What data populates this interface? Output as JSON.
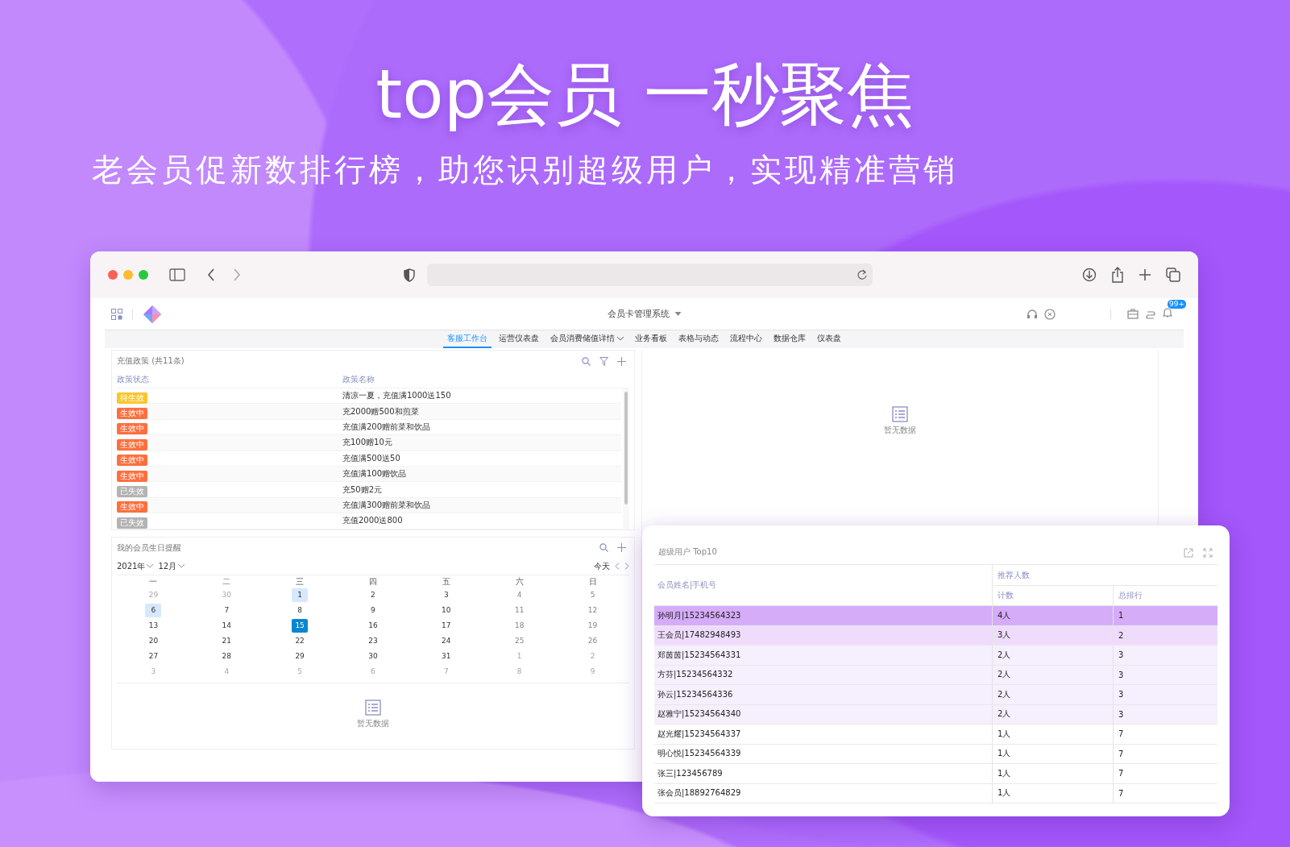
{
  "headline": {
    "title": "top会员 一秒聚焦",
    "subtitle": "老会员促新数排行榜，助您识别超级用户，实现精准营销"
  },
  "app": {
    "title": "会员卡管理系统",
    "badge": "99+",
    "nav": [
      {
        "label": "客服工作台",
        "selected": true,
        "has_menu": false
      },
      {
        "label": "运营仪表盘",
        "selected": false,
        "has_menu": false
      },
      {
        "label": "会员消费储值详情",
        "selected": false,
        "has_menu": true
      },
      {
        "label": "业务看板",
        "selected": false,
        "has_menu": false
      },
      {
        "label": "表格与动态",
        "selected": false,
        "has_menu": false
      },
      {
        "label": "流程中心",
        "selected": false,
        "has_menu": false
      },
      {
        "label": "数据仓库",
        "selected": false,
        "has_menu": false
      },
      {
        "label": "仪表盘",
        "selected": false,
        "has_menu": false
      }
    ]
  },
  "policy_table": {
    "title": "充值政策 (共11条)",
    "columns": [
      "政策状态",
      "政策名称"
    ],
    "rows": [
      {
        "status": "待生效",
        "kind": "pending",
        "name": "清凉一夏，充值满1000送150"
      },
      {
        "status": "生效中",
        "kind": "active",
        "name": "充2000赠500和煎菜"
      },
      {
        "status": "生效中",
        "kind": "active",
        "name": "充值满200赠前菜和饮品"
      },
      {
        "status": "生效中",
        "kind": "active",
        "name": "充100赠10元"
      },
      {
        "status": "生效中",
        "kind": "active",
        "name": "充值满500送50"
      },
      {
        "status": "生效中",
        "kind": "active",
        "name": "充值满100赠饮品"
      },
      {
        "status": "已失效",
        "kind": "expired",
        "name": "充50赠2元"
      },
      {
        "status": "生效中",
        "kind": "active",
        "name": "充值满300赠前菜和饮品"
      },
      {
        "status": "已失效",
        "kind": "expired",
        "name": "充值2000送800"
      }
    ]
  },
  "birthday_calendar": {
    "title": "我的会员生日提醒",
    "year": "2021年",
    "month": "12月",
    "today": "今天",
    "weekdays": [
      "一",
      "二",
      "三",
      "四",
      "五",
      "六",
      "日"
    ],
    "weeks": [
      [
        {
          "day": "29",
          "kind": "outside",
          "marked": false,
          "selected": false
        },
        {
          "day": "30",
          "kind": "outside",
          "marked": false,
          "selected": false
        },
        {
          "day": "1",
          "kind": "weekday",
          "marked": true,
          "selected": false
        },
        {
          "day": "2",
          "kind": "weekday",
          "marked": false,
          "selected": false
        },
        {
          "day": "3",
          "kind": "weekday",
          "marked": false,
          "selected": false
        },
        {
          "day": "4",
          "kind": "weekend",
          "marked": false,
          "selected": false
        },
        {
          "day": "5",
          "kind": "weekend",
          "marked": false,
          "selected": false
        }
      ],
      [
        {
          "day": "6",
          "kind": "weekday",
          "marked": true,
          "selected": false
        },
        {
          "day": "7",
          "kind": "weekday",
          "marked": false,
          "selected": false
        },
        {
          "day": "8",
          "kind": "weekday",
          "marked": false,
          "selected": false
        },
        {
          "day": "9",
          "kind": "weekday",
          "marked": false,
          "selected": false
        },
        {
          "day": "10",
          "kind": "weekday",
          "marked": false,
          "selected": false
        },
        {
          "day": "11",
          "kind": "weekend",
          "marked": false,
          "selected": false
        },
        {
          "day": "12",
          "kind": "weekend",
          "marked": false,
          "selected": false
        }
      ],
      [
        {
          "day": "13",
          "kind": "weekday",
          "marked": false,
          "selected": false
        },
        {
          "day": "14",
          "kind": "weekday",
          "marked": false,
          "selected": false
        },
        {
          "day": "15",
          "kind": "weekday",
          "marked": false,
          "selected": true
        },
        {
          "day": "16",
          "kind": "weekday",
          "marked": false,
          "selected": false
        },
        {
          "day": "17",
          "kind": "weekday",
          "marked": false,
          "selected": false
        },
        {
          "day": "18",
          "kind": "weekend",
          "marked": false,
          "selected": false
        },
        {
          "day": "19",
          "kind": "weekend",
          "marked": false,
          "selected": false
        }
      ],
      [
        {
          "day": "20",
          "kind": "weekday",
          "marked": false,
          "selected": false
        },
        {
          "day": "21",
          "kind": "weekday",
          "marked": false,
          "selected": false
        },
        {
          "day": "22",
          "kind": "weekday",
          "marked": false,
          "selected": false
        },
        {
          "day": "23",
          "kind": "weekday",
          "marked": false,
          "selected": false
        },
        {
          "day": "24",
          "kind": "weekday",
          "marked": false,
          "selected": false
        },
        {
          "day": "25",
          "kind": "weekend",
          "marked": false,
          "selected": false
        },
        {
          "day": "26",
          "kind": "weekend",
          "marked": false,
          "selected": false
        }
      ],
      [
        {
          "day": "27",
          "kind": "weekday",
          "marked": false,
          "selected": false
        },
        {
          "day": "28",
          "kind": "weekday",
          "marked": false,
          "selected": false
        },
        {
          "day": "29",
          "kind": "weekday",
          "marked": false,
          "selected": false
        },
        {
          "day": "30",
          "kind": "weekday",
          "marked": false,
          "selected": false
        },
        {
          "day": "31",
          "kind": "weekday",
          "marked": false,
          "selected": false
        },
        {
          "day": "1",
          "kind": "outside",
          "marked": false,
          "selected": false
        },
        {
          "day": "2",
          "kind": "outside",
          "marked": false,
          "selected": false
        }
      ],
      [
        {
          "day": "3",
          "kind": "outside",
          "marked": false,
          "selected": false
        },
        {
          "day": "4",
          "kind": "outside",
          "marked": false,
          "selected": false
        },
        {
          "day": "5",
          "kind": "outside",
          "marked": false,
          "selected": false
        },
        {
          "day": "6",
          "kind": "outside",
          "marked": false,
          "selected": false
        },
        {
          "day": "7",
          "kind": "outside",
          "marked": false,
          "selected": false
        },
        {
          "day": "8",
          "kind": "outside",
          "marked": false,
          "selected": false
        },
        {
          "day": "9",
          "kind": "outside",
          "marked": false,
          "selected": false
        }
      ]
    ],
    "empty_text": "暂无数据"
  },
  "right_panel": {
    "empty_text": "暂无数据"
  },
  "top10": {
    "title": "超级用户 Top10",
    "name_column": "会员姓名|手机号",
    "group_column": "推荐人数",
    "count_column": "计数",
    "rank_column": "总排行",
    "rows": [
      {
        "name": "孙明月|15234564323",
        "count": "4人",
        "rank": "1",
        "color": "#d5acf8"
      },
      {
        "name": "王会员|17482948493",
        "count": "3人",
        "rank": "2",
        "color": "#efdcfd"
      },
      {
        "name": "郑茵茵|15234564331",
        "count": "2人",
        "rank": "3",
        "color": "#f6effe"
      },
      {
        "name": "方芬|15234564332",
        "count": "2人",
        "rank": "3",
        "color": "#f6effe"
      },
      {
        "name": "孙云|15234564336",
        "count": "2人",
        "rank": "3",
        "color": "#f6effe"
      },
      {
        "name": "赵雅宁|15234564340",
        "count": "2人",
        "rank": "3",
        "color": "#f6effe"
      },
      {
        "name": "赵光耀|15234564337",
        "count": "1人",
        "rank": "7",
        "color": "#ffffff"
      },
      {
        "name": "明心悦|15234564339",
        "count": "1人",
        "rank": "7",
        "color": "#ffffff"
      },
      {
        "name": "张三|123456789",
        "count": "1人",
        "rank": "7",
        "color": "#ffffff"
      },
      {
        "name": "张会员|18892764829",
        "count": "1人",
        "rank": "7",
        "color": "#ffffff"
      }
    ]
  }
}
